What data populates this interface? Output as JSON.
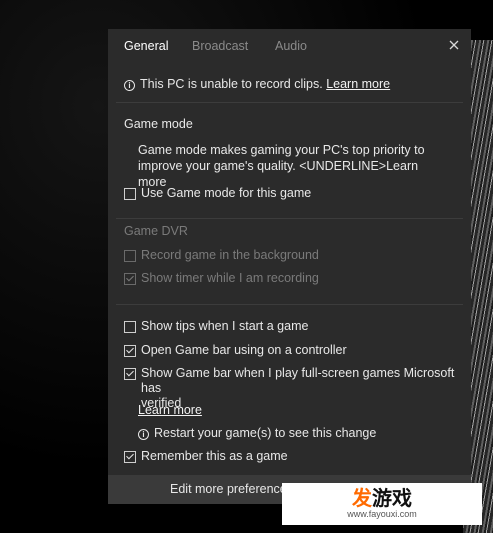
{
  "tabs": [
    {
      "label": "General",
      "active": true
    },
    {
      "label": "Broadcast",
      "active": false
    },
    {
      "label": "Audio",
      "active": false
    }
  ],
  "notice": {
    "text": "This PC is unable to record clips.",
    "link": "Learn more"
  },
  "game_mode": {
    "heading": "Game mode",
    "desc_line1": "Game mode makes gaming your PC's top priority to",
    "desc_line2": "improve your game's quality. <UNDERLINE>Learn more",
    "checkbox": {
      "label": "Use Game mode for this game",
      "checked": false
    }
  },
  "game_dvr": {
    "heading": "Game DVR",
    "record_bg": {
      "label": "Record game in the background",
      "checked": false,
      "disabled": true
    },
    "show_timer": {
      "label": "Show timer while I am recording",
      "checked": true,
      "disabled": true
    }
  },
  "options": {
    "show_tips": {
      "label": "Show tips when I start a game",
      "checked": false
    },
    "open_gamebar": {
      "label": "Open Game bar using  on a controller",
      "checked": true
    },
    "show_gamebar_full_line1": "Show Game bar when I play full-screen games Microsoft has",
    "show_gamebar_full_line2": "verified",
    "show_gamebar_full_checked": true,
    "learn_more": "Learn more",
    "restart_note": "Restart your game(s) to see this change",
    "remember": {
      "label": "Remember this as a game",
      "checked": true
    }
  },
  "footer": {
    "label": "Edit more preferences in Windows Settings"
  },
  "watermark": {
    "brand_a": "发",
    "brand_b": "游戏",
    "url": "www.fayouxi.com"
  },
  "colors": {
    "panel_bg": "#2b2b2b",
    "footer_bg": "#3a3a3a",
    "text": "#e8e8e8",
    "dim_text": "#7a7a7a",
    "watermark_orange": "#ff6a00"
  }
}
